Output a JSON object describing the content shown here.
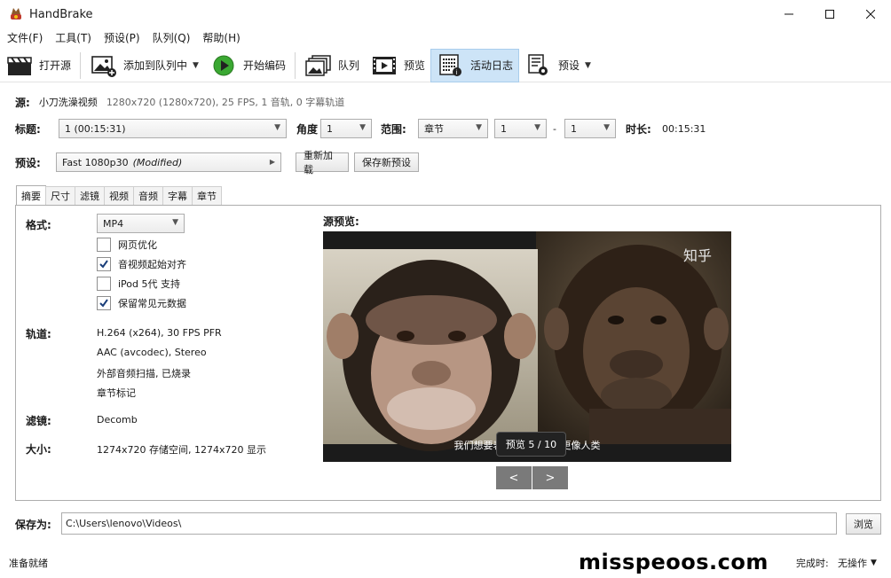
{
  "window": {
    "title": "HandBrake"
  },
  "menu": [
    "文件(F)",
    "工具(T)",
    "预设(P)",
    "队列(Q)",
    "帮助(H)"
  ],
  "toolbar": {
    "open_source": "打开源",
    "add_to_queue": "添加到队列中",
    "start_encode": "开始编码",
    "queue": "队列",
    "preview": "预览",
    "activity_log": "活动日志",
    "presets": "预设"
  },
  "source": {
    "label": "源:",
    "name": "小刀洗澡视频",
    "details": "1280x720 (1280x720), 25 FPS, 1 音轨, 0 字幕轨道"
  },
  "title_row": {
    "title_label": "标题:",
    "title_value": "1 (00:15:31)",
    "angle_label": "角度",
    "angle_value": "1",
    "range_label": "范围:",
    "range_mode": "章节",
    "range_start": "1",
    "range_dash": "-",
    "range_end": "1",
    "duration_label": "时长:",
    "duration_value": "00:15:31"
  },
  "preset_row": {
    "label": "预设:",
    "preset_name": "Fast 1080p30",
    "preset_modified": "(Modified)",
    "reload_button": "重新加载",
    "save_new_button": "保存新预设"
  },
  "tabs": [
    "摘要",
    "尺寸",
    "滤镜",
    "视频",
    "音频",
    "字幕",
    "章节"
  ],
  "summary": {
    "format_label": "格式:",
    "format_value": "MP4",
    "options": [
      {
        "label": "网页优化",
        "checked": false
      },
      {
        "label": "音视频起始对齐",
        "checked": true
      },
      {
        "label": "iPod 5代 支持",
        "checked": false
      },
      {
        "label": "保留常见元数据",
        "checked": true
      }
    ],
    "tracks_label": "轨道:",
    "tracks": [
      "H.264 (x264), 30 FPS PFR",
      "AAC (avcodec), Stereo",
      "外部音频扫描, 已烧录",
      "章节标记"
    ],
    "filters_label": "滤镜:",
    "filters_value": "Decomb",
    "size_label": "大小:",
    "size_value": "1274x720 存储空间, 1274x720 显示",
    "preview_label": "源预览:",
    "watermark": "知乎",
    "subtitle_text": "我们想要表现出它们比例更像人类",
    "preview_counter": "预览 5 / 10",
    "prev_button": "<",
    "next_button": ">"
  },
  "save_row": {
    "label": "保存为:",
    "path": "C:\\Users\\lenovo\\Videos\\",
    "browse_button": "浏览"
  },
  "status": {
    "ready": "准备就绪",
    "when_done_label": "完成时:",
    "when_done_value": "无操作",
    "overlay_text": "misspeoos.com"
  },
  "colors": {
    "active_tool_bg": "#cde4f7",
    "play_green": "#3aa832"
  }
}
